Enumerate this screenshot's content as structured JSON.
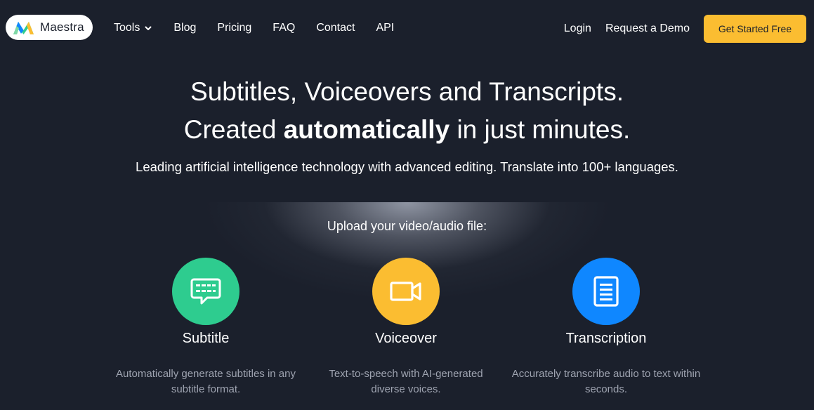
{
  "brand": {
    "name": "Maestra"
  },
  "nav": {
    "tools_label": "Tools",
    "blog_label": "Blog",
    "pricing_label": "Pricing",
    "faq_label": "FAQ",
    "contact_label": "Contact",
    "api_label": "API",
    "login_label": "Login",
    "demo_label": "Request a Demo",
    "cta_label": "Get Started Free"
  },
  "hero": {
    "title_line1": "Subtitles, Voiceovers and Transcripts.",
    "title_line2_prefix": "Created ",
    "title_line2_bold": "automatically",
    "title_line2_suffix": " in just minutes.",
    "subtitle": "Leading artificial intelligence technology with advanced editing. Translate into 100+ languages."
  },
  "upload": {
    "title": "Upload your video/audio file:",
    "options": [
      {
        "label": "Subtitle",
        "icon": "subtitle-icon",
        "color": "#2ecc8f",
        "description": "Automatically generate subtitles in any subtitle format."
      },
      {
        "label": "Voiceover",
        "icon": "video-camera-icon",
        "color": "#fbbd31",
        "description": "Text-to-speech with AI-generated diverse voices."
      },
      {
        "label": "Transcription",
        "icon": "document-icon",
        "color": "#0f87ff",
        "description": "Accurately transcribe audio to text within seconds."
      }
    ]
  },
  "colors": {
    "background": "#1b202c",
    "accent_yellow": "#fbbd31",
    "accent_green": "#2ecc8f",
    "accent_blue": "#0f87ff",
    "muted_text": "#9ea3b0"
  }
}
